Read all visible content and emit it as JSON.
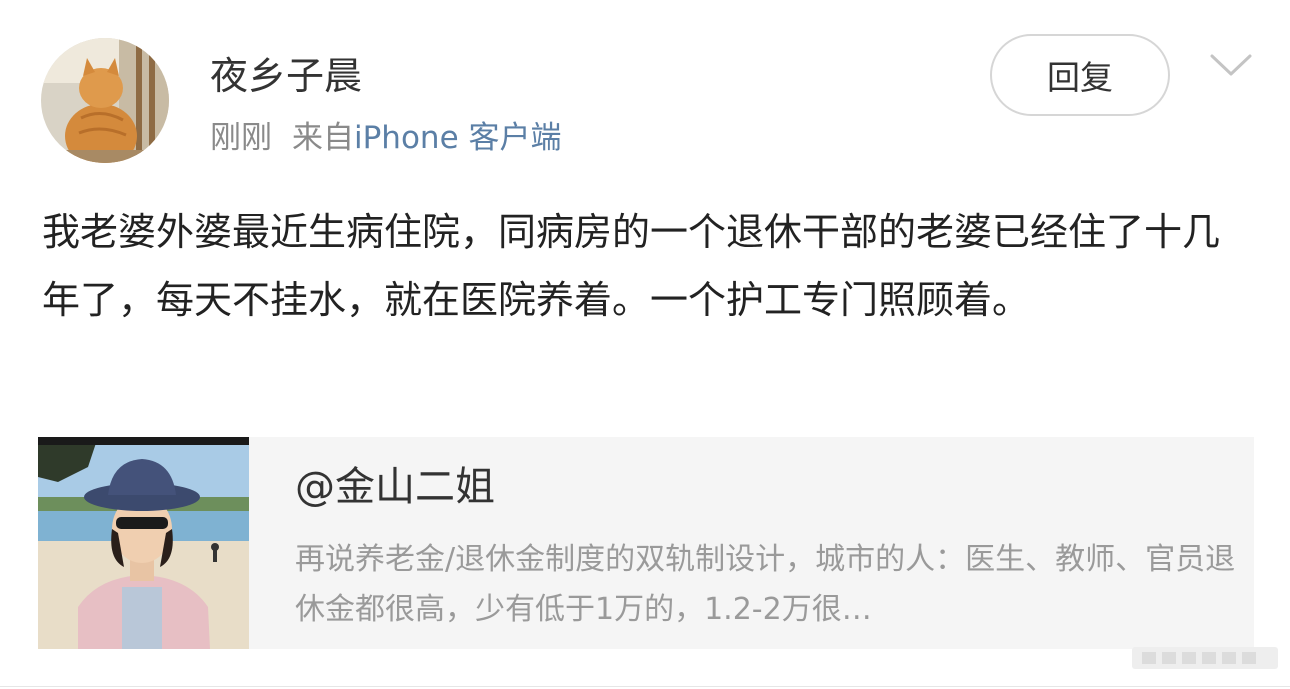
{
  "post": {
    "author": "夜乡子晨",
    "time": "刚刚",
    "source_prefix": "来自",
    "source": "iPhone 客户端",
    "reply_label": "回复",
    "body": "我老婆外婆最近生病住院，同病房的一个退休干部的老婆已经住了十几年了，每天不挂水，就在医院养着。一个护工专门照顾着。"
  },
  "quoted_card": {
    "title": "@金山二姐",
    "description": "再说养老金/退休金制度的双轨制设计，城市的人：医生、教师、官员退休金都很高，少有低于1万的，1.2-2万很…"
  },
  "icons": {
    "avatar": "cat-photo-avatar",
    "dropdown": "chevron-down-icon",
    "thumbnail": "woman-beach-photo"
  },
  "colors": {
    "meta_gray": "#8a8a8a",
    "source_blue": "#5b7fa6",
    "card_bg": "#f5f5f5"
  }
}
